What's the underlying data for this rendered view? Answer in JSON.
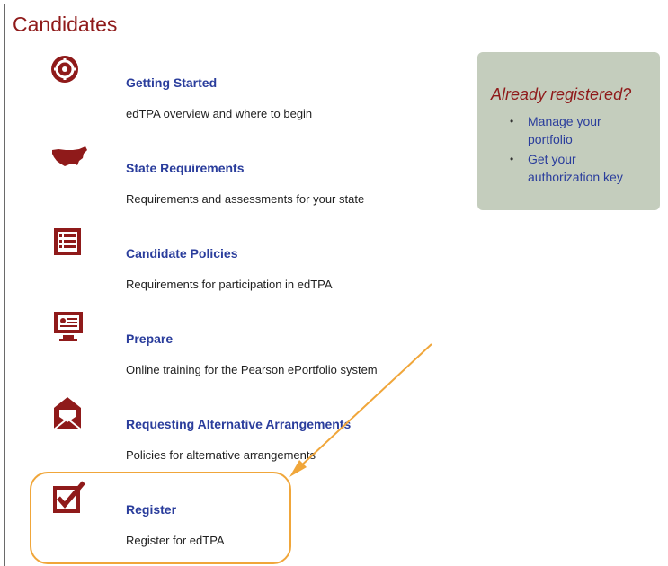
{
  "page": {
    "title": "Candidates"
  },
  "items": [
    {
      "icon": "gear-globe-icon",
      "title": "Getting Started",
      "desc": "edTPA overview and where to begin"
    },
    {
      "icon": "usa-map-icon",
      "title": "State Requirements",
      "desc": "Requirements and assessments for your state"
    },
    {
      "icon": "list-document-icon",
      "title": "Candidate Policies",
      "desc": "Requirements for participation in edTPA"
    },
    {
      "icon": "monitor-icon",
      "title": "Prepare",
      "desc": "Online training for the Pearson ePortfolio system"
    },
    {
      "icon": "envelope-icon",
      "title": "Requesting Alternative Arrangements",
      "desc": "Policies for alternative arrangements"
    },
    {
      "icon": "checkbox-icon",
      "title": "Register",
      "desc": "Register for edTPA"
    }
  ],
  "sidebar": {
    "heading": "Already registered?",
    "links": [
      {
        "line1": "Manage your",
        "line2": "portfolio"
      },
      {
        "line1": "Get your",
        "line2": "authorization key"
      }
    ]
  },
  "colors": {
    "accent": "#8f1a1a",
    "link": "#2a3d9c",
    "highlight": "#f0a63a",
    "sidebar_bg": "#c4cdbd"
  }
}
